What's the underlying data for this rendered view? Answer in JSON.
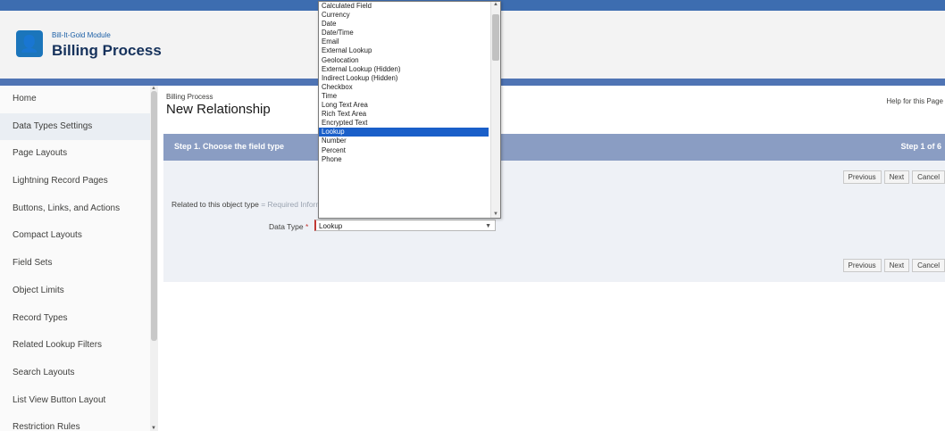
{
  "header": {
    "app_subtitle": "Bill-It-Gold Module",
    "app_title": "Billing Process",
    "logo_icon": "person-icon"
  },
  "sidebar": {
    "items": [
      {
        "label": "Home",
        "active": false
      },
      {
        "label": "Data Types Settings",
        "active": true
      },
      {
        "label": "Page Layouts",
        "active": false
      },
      {
        "label": "Lightning Record Pages",
        "active": false
      },
      {
        "label": "Buttons, Links, and Actions",
        "active": false
      },
      {
        "label": "Compact Layouts",
        "active": false
      },
      {
        "label": "Field Sets",
        "active": false
      },
      {
        "label": "Object Limits",
        "active": false
      },
      {
        "label": "Record Types",
        "active": false
      },
      {
        "label": "Related Lookup Filters",
        "active": false
      },
      {
        "label": "Search Layouts",
        "active": false
      },
      {
        "label": "List View Button Layout",
        "active": false
      },
      {
        "label": "Restriction Rules",
        "active": false
      }
    ]
  },
  "main": {
    "breadcrumb": "Billing Process",
    "page_title": "New Relationship",
    "help_link": "Help for this Page",
    "step_text": "Step 1. Choose the field type",
    "step_count": "Step 1 of 6",
    "buttons_top": [
      "Previous",
      "Next",
      "Cancel"
    ],
    "buttons_bottom": [
      "Previous",
      "Next",
      "Cancel"
    ],
    "field_label": "Related to this object type",
    "required_hint": "= Required Information",
    "type_label": "Data Type",
    "type_value": "Lookup"
  },
  "dropdown": {
    "options": [
      "Calculated Field",
      "Currency",
      "Date",
      "Date/Time",
      "Email",
      "External Lookup",
      "Geolocation",
      "External Lookup (Hidden)",
      "Indirect Lookup (Hidden)",
      "Checkbox",
      "Time",
      "Long Text Area",
      "Rich Text Area",
      "Encrypted Text",
      "Lookup",
      "Number",
      "Percent",
      "Phone"
    ],
    "selected_index": 14
  },
  "colors": {
    "accent": "#4f74b4",
    "header_stripe": "#3d6db0",
    "panel_head": "#8a9dc3",
    "selected_option": "#1a5fc9",
    "required": "#c23934"
  }
}
